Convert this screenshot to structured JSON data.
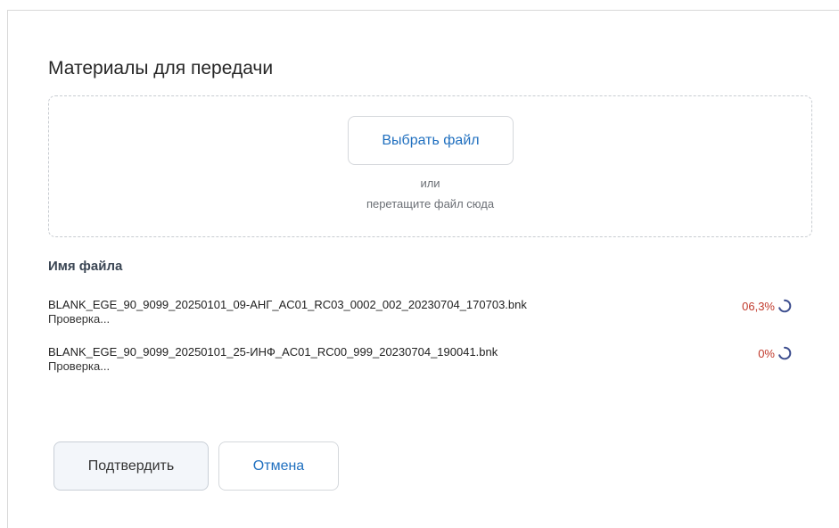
{
  "dialog": {
    "title": "Материалы для передачи"
  },
  "dropzone": {
    "choose_label": "Выбрать файл",
    "or_text": "или",
    "drag_text": "перетащите файл сюда"
  },
  "files": {
    "header": "Имя файла",
    "items": [
      {
        "name": "BLANK_EGE_90_9099_20250101_09-АНГ_AC01_RC03_0002_002_20230704_170703.bnk",
        "status": "Проверка...",
        "progress": "06,3%",
        "progress_icon": "spinner-icon"
      },
      {
        "name": "BLANK_EGE_90_9099_20250101_25-ИНФ_AC01_RC00_999_20230704_190041.bnk",
        "status": "Проверка...",
        "progress": "0%",
        "progress_icon": "spinner-icon"
      }
    ]
  },
  "actions": {
    "confirm_label": "Подтвердить",
    "cancel_label": "Отмена"
  },
  "colors": {
    "accent": "#1f6fbf",
    "progress_text": "#c0392b",
    "spinner": "#3e4f8f"
  }
}
